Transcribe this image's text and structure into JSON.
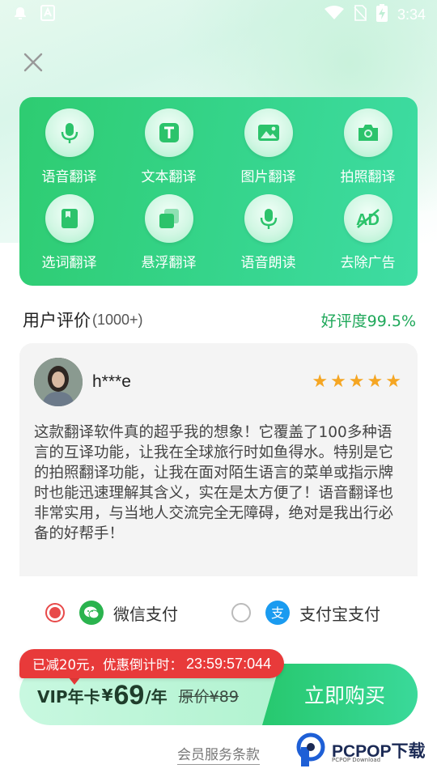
{
  "status_bar": {
    "time": "3:34"
  },
  "features": [
    {
      "label": "语音翻译",
      "icon": "mic-icon"
    },
    {
      "label": "文本翻译",
      "icon": "text-icon"
    },
    {
      "label": "图片翻译",
      "icon": "image-icon"
    },
    {
      "label": "拍照翻译",
      "icon": "camera-icon"
    },
    {
      "label": "选词翻译",
      "icon": "book-icon"
    },
    {
      "label": "悬浮翻译",
      "icon": "float-window-icon"
    },
    {
      "label": "语音朗读",
      "icon": "mic-icon"
    },
    {
      "label": "去除广告",
      "icon": "ad-block-icon"
    }
  ],
  "reviews": {
    "title": "用户评价",
    "count": "(1000+)",
    "rate": "好评度99.5%",
    "item": {
      "name": "h***e",
      "stars": 5,
      "text": "这款翻译软件真的超乎我的想象！它覆盖了100多种语言的互译功能，让我在全球旅行时如鱼得水。特别是它的拍照翻译功能，让我在面对陌生语言的菜单或指示牌时也能迅速理解其含义，实在是太方便了！语音翻译也非常实用，与当地人交流完全无障碍，绝对是我出行必备的好帮手！"
    }
  },
  "payment": {
    "wechat": {
      "label": "微信支付",
      "selected": true
    },
    "alipay": {
      "label": "支付宝支付",
      "selected": false
    }
  },
  "purchase": {
    "promo_label": "已减20元，优惠倒计时：",
    "promo_time": "23:59:57:044",
    "plan_name": "VIP年卡",
    "currency": "¥",
    "price": "69",
    "unit": "/年",
    "original": "原价¥89",
    "buy_label": "立即购买"
  },
  "terms": "会员服务条款",
  "watermark": {
    "name": "PCPOP下载",
    "sub": "PCPOP Download"
  },
  "colors": {
    "accent": "#2ecc71",
    "promo": "#e83a3a",
    "rate": "#1fa85a",
    "star": "#f5a623"
  }
}
